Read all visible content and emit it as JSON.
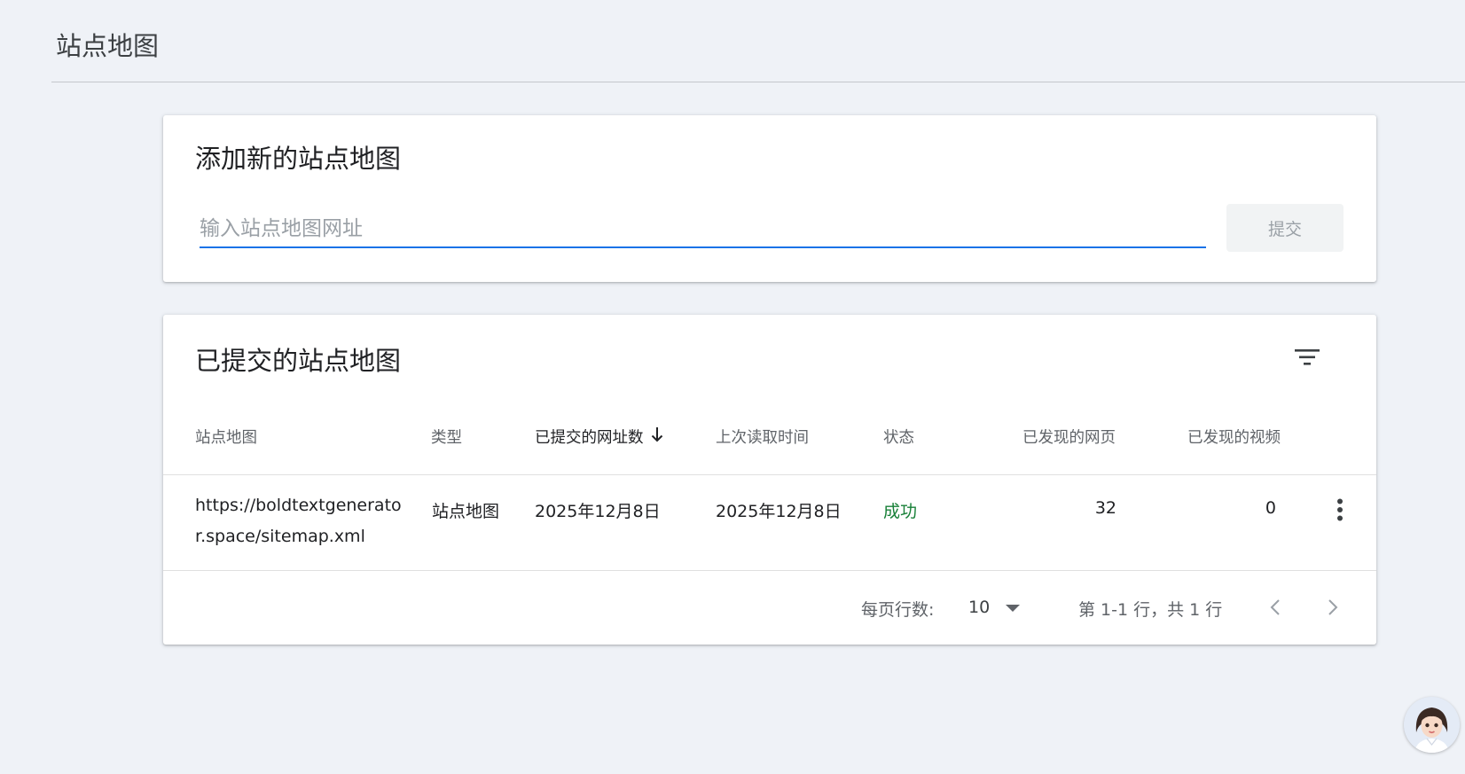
{
  "page": {
    "title": "站点地图"
  },
  "add_card": {
    "title": "添加新的站点地图",
    "input_placeholder": "输入站点地图网址",
    "input_value": "",
    "submit_label": "提交"
  },
  "submitted_card": {
    "title": "已提交的站点地图",
    "columns": {
      "sitemap": "站点地图",
      "type": "类型",
      "submitted": "已提交的网址数",
      "last_read": "上次读取时间",
      "status": "状态",
      "discovered_pages": "已发现的网页",
      "discovered_videos": "已发现的视频"
    },
    "sorted_column": "submitted",
    "rows": [
      {
        "sitemap": "https://boldtextgenerator.space/sitemap.xml",
        "type": "站点地图",
        "submitted": "2025年12月8日",
        "last_read": "2025年12月8日",
        "status": "成功",
        "discovered_pages": "32",
        "discovered_videos": "0"
      }
    ],
    "pagination": {
      "rows_per_page_label": "每页行数:",
      "rows_per_page_value": "10",
      "range_label": "第 1-1 行，共 1 行"
    }
  },
  "colors": {
    "background": "#eff2f7",
    "accent": "#1a73e8",
    "success": "#188038",
    "muted_text": "#5f6368"
  },
  "icons": [
    "filter-icon",
    "sort-down-arrow-icon",
    "more-vert-icon",
    "dropdown-arrow-icon",
    "chevron-left-icon",
    "chevron-right-icon",
    "avatar-icon"
  ]
}
